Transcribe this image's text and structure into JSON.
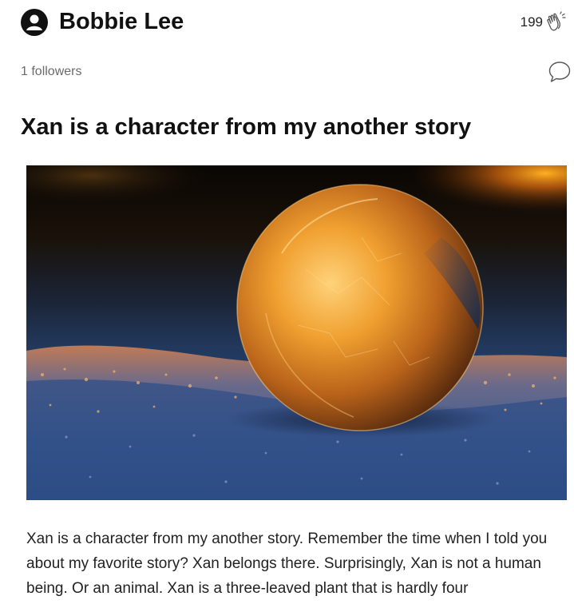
{
  "author": {
    "name": "Bobbie Lee",
    "followers": "1 followers",
    "avatar_icon": "user-avatar-icon"
  },
  "engagement": {
    "claps": "199",
    "clap_icon": "clap-icon",
    "comment_icon": "comment-icon"
  },
  "post": {
    "title": "Xan is a character from my another story",
    "image_subject": "frozen-bubble-on-snow-at-sunset",
    "body": "Xan is a character from my another story. Remember the time when I told you about my favorite story? Xan belongs there. Surprisingly, Xan is not a human being. Or an animal. Xan is a three-leaved plant that is hardly four"
  },
  "colors": {
    "text": "#111111",
    "muted": "#6b6b6b",
    "bubble_glow": "#f0a030"
  }
}
